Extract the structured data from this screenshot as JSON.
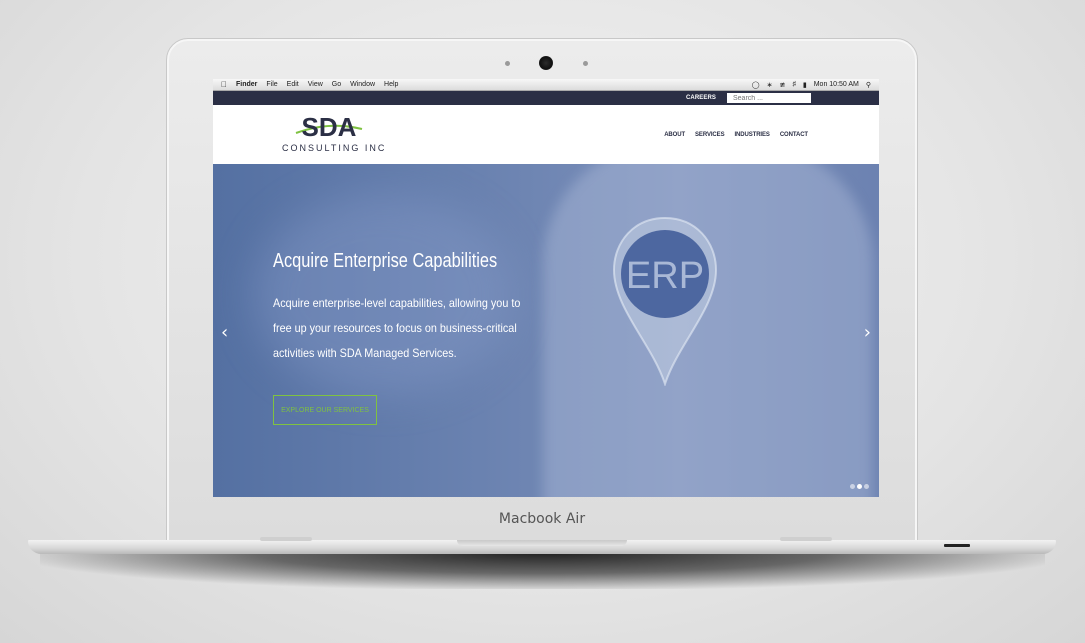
{
  "device": {
    "label": "Macbook Air"
  },
  "menubar": {
    "items": [
      "Finder",
      "File",
      "Edit",
      "View",
      "Go",
      "Window",
      "Help"
    ],
    "clock": "Mon 10:50 AM"
  },
  "topbar": {
    "careers": "CAREERS",
    "search_placeholder": "Search ..."
  },
  "logo": {
    "mark": "SDA",
    "subtitle": "CONSULTING INC"
  },
  "nav": {
    "items": [
      "ABOUT",
      "SERVICES",
      "INDUSTRIES",
      "CONTACT"
    ]
  },
  "hero": {
    "title": "Acquire Enterprise Capabilities",
    "text": "Acquire enterprise-level capabilities, allowing you to free up your resources to focus on business-critical activities with SDA Managed Services.",
    "cta": "EXPLORE OUR SERVICES",
    "pin_label": "ERP",
    "slide_count": 3,
    "active_slide": 2
  },
  "colors": {
    "navy": "#2b2f45",
    "green": "#7fc241",
    "hero_blue": "#6a82b0"
  }
}
